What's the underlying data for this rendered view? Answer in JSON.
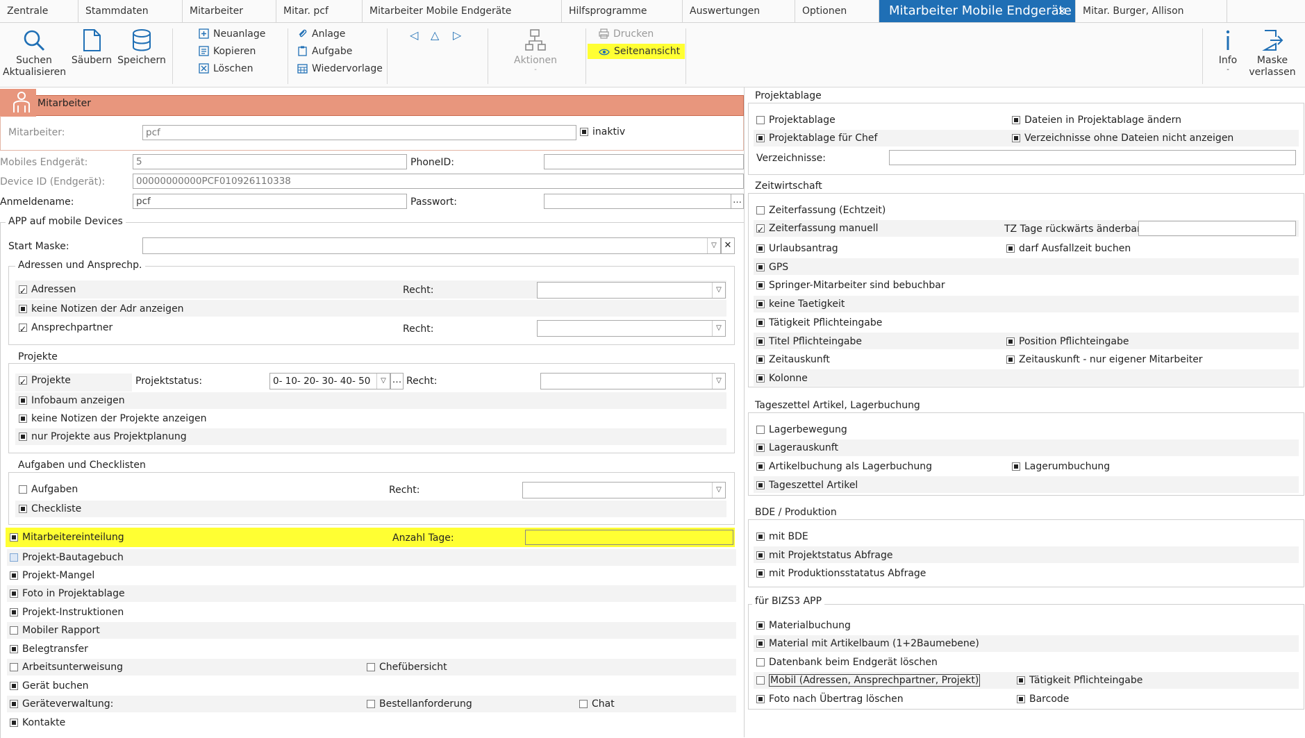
{
  "tabs": [
    "Zentrale",
    "Stammdaten",
    "Mitarbeiter",
    "Mitar. pcf",
    "Mitarbeiter Mobile Endgeräte",
    "Hilfsprogramme",
    "Auswertungen",
    "Optionen",
    "Mitarbeiter Mobile Endgeräte",
    "Mitar. Burger, Allison"
  ],
  "tab_close": "×",
  "ribbon": {
    "search_line1": "Suchen",
    "search_line2": "Aktualisieren",
    "clean": "Säubern",
    "save": "Speichern",
    "new": "Neuanlage",
    "copy": "Kopieren",
    "delete": "Löschen",
    "attachment": "Anlage",
    "task": "Aufgabe",
    "resubmission": "Wiedervorlage",
    "actions": "Aktionen",
    "actions_dot": "-",
    "print": "Drucken",
    "page_view": "Seitenansicht",
    "info": "Info",
    "info_dot": "-",
    "leave_line1": "Maske",
    "leave_line2": "verlassen"
  },
  "employee": {
    "header": "Mitarbeiter",
    "label": "Mitarbeiter:",
    "value": "pcf",
    "inactive": "inaktiv"
  },
  "device": {
    "mobile_label": "Mobiles Endgerät:",
    "mobile_value": "5",
    "phoneid_label": "PhoneID:",
    "phoneid_value": "",
    "deviceid_label": "Device ID (Endgerät):",
    "deviceid_value": "00000000000PCF010926110338",
    "login_label": "Anmeldename:",
    "login_value": "pcf",
    "password_label": "Passwort:",
    "password_btn": "..."
  },
  "app": {
    "title": "APP auf mobile Devices",
    "start_mask_label": "Start Maske:",
    "start_mask_clear": "✕",
    "addresses_group": "Adressen und Ansprechp.",
    "addresses": "Adressen",
    "right_label": "Recht:",
    "no_notes_addr": "keine Notizen der Adr anzeigen",
    "contacts_person": "Ansprechpartner",
    "projects_group": "Projekte",
    "projects": "Projekte",
    "project_status_label": "Projektstatus:",
    "project_status_value": "0- 10- 20- 30- 40- 50",
    "infotree": "Infobaum anzeigen",
    "no_notes_proj": "keine Notizen der Projekte anzeigen",
    "only_planning": "nur Projekte aus Projektplanung",
    "tasks_group": "Aufgaben und Checklisten",
    "tasks": "Aufgaben",
    "checklist": "Checkliste",
    "staff_assignment": "Mitarbeitereinteilung",
    "days_label": "Anzahl Tage:",
    "construction_diary": "Projekt-Bautagebuch",
    "defects": "Projekt-Mangel",
    "photo_storage": "Foto in Projektablage",
    "instructions": "Projekt-Instruktionen",
    "mobile_report": "Mobiler Rapport",
    "doc_transfer": "Belegtransfer",
    "work_instruction": "Arbeitsunterweisung",
    "boss_overview": "Chefübersicht",
    "book_device": "Gerät buchen",
    "device_admin": "Geräteverwaltung:",
    "order_request": "Bestellanforderung",
    "chat": "Chat",
    "contacts": "Kontakte"
  },
  "right": {
    "storage_group": "Projektablage",
    "storage": "Projektablage",
    "change_files": "Dateien in Projektablage ändern",
    "storage_boss": "Projektablage für Chef",
    "hide_empty_dirs": "Verzeichnisse ohne Dateien nicht anzeigen",
    "dirs_label": "Verzeichnisse:",
    "time_group": "Zeitwirtschaft",
    "time_realtime": "Zeiterfassung (Echtzeit)",
    "time_manual": "Zeiterfassung manuell",
    "tz_days_label": "TZ Tage rückwärts änderbar:",
    "vacation": "Urlaubsantrag",
    "book_absence": "darf Ausfallzeit buchen",
    "gps": "GPS",
    "jumper": "Springer-Mitarbeiter sind bebuchbar",
    "no_activity": "keine Taetigkeit",
    "activity_required": "Tätigkeit Pflichteingabe",
    "title_required": "Titel Pflichteingabe",
    "position_required": "Position Pflichteingabe",
    "time_info": "Zeitauskunft",
    "time_info_own": "Zeitauskunft - nur eigener Mitarbeiter",
    "column": "Kolonne",
    "daily_group": "Tageszettel Artikel, Lagerbuchung",
    "stock_movement": "Lagerbewegung",
    "stock_info": "Lagerauskunft",
    "article_booking": "Artikelbuchung als Lagerbuchung",
    "restock": "Lagerumbuchung",
    "daily_article": "Tageszettel Artikel",
    "bde_group": "BDE / Produktion",
    "with_bde": "mit BDE",
    "project_status_query": "mit Projektstatus Abfrage",
    "production_status_query": "mit Produktionsstatatus Abfrage",
    "bizs_group": "für BIZS3 APP",
    "material_booking": "Materialbuchung",
    "material_tree": "Material mit Artikelbaum (1+2Baumebene)",
    "delete_db": "Datenbank beim Endgerät löschen",
    "mobile_addr": "Mobil (Adressen, Ansprechpartner, Projekt)",
    "activity_required2": "Tätigkeit Pflichteingabe",
    "photo_delete": "Foto nach Übertrag löschen",
    "barcode": "Barcode"
  },
  "colors": {
    "accent_blue": "#1f6fb5",
    "header_salmon": "#e8967d",
    "highlight_yellow": "#ffff33"
  }
}
